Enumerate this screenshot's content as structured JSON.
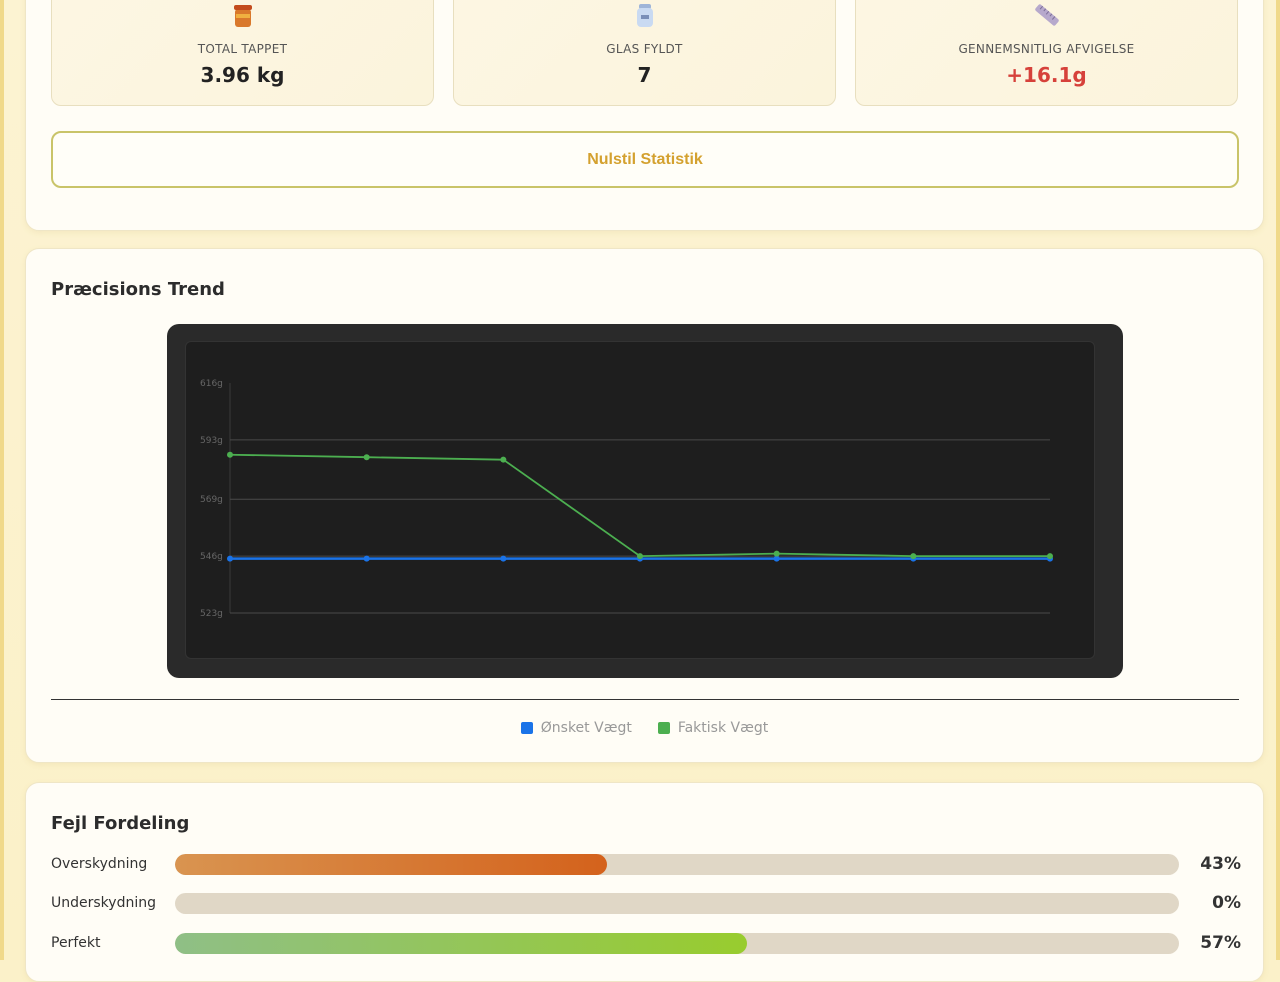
{
  "stats": [
    {
      "label": "TOTAL TAPPET",
      "value": "3.96 kg",
      "icon": "honey-jar-icon"
    },
    {
      "label": "GLAS FYLDT",
      "value": "7",
      "icon": "glass-jar-icon"
    },
    {
      "label": "GENNEMSNITLIG AFVIGELSE",
      "value": "+16.1g",
      "icon": "ruler-icon",
      "value_color": "#d6413a"
    }
  ],
  "reset_button": "Nulstil Statistik",
  "trend": {
    "title": "Præcisions Trend"
  },
  "chart_data": {
    "type": "line",
    "x": [
      1,
      2,
      3,
      4,
      5,
      6,
      7
    ],
    "ylim": [
      523,
      616
    ],
    "yticks": [
      616,
      593,
      569,
      546,
      523
    ],
    "ytick_labels": [
      "616g",
      "593g",
      "569g",
      "546g",
      "523g"
    ],
    "grid": true,
    "legend_placement": "bottom",
    "series": [
      {
        "name": "Ønsket Vægt",
        "color": "#1a73e8",
        "values": [
          545,
          545,
          545,
          545,
          545,
          545,
          545
        ]
      },
      {
        "name": "Faktisk Vægt",
        "color": "#4caf50",
        "values": [
          587,
          586,
          585,
          546,
          547,
          546,
          546
        ]
      }
    ]
  },
  "errors": {
    "title": "Fejl Fordeling",
    "rows": [
      {
        "name": "Overskydning",
        "percent": 43,
        "label": "43%",
        "gradient": [
          "#d99450",
          "#d4621c"
        ]
      },
      {
        "name": "Underskydning",
        "percent": 0,
        "label": "0%",
        "gradient": [
          "#d4621c",
          "#d4621c"
        ]
      },
      {
        "name": "Perfekt",
        "percent": 57,
        "label": "57%",
        "gradient": [
          "#8fbf86",
          "#98cc2e"
        ]
      }
    ]
  }
}
